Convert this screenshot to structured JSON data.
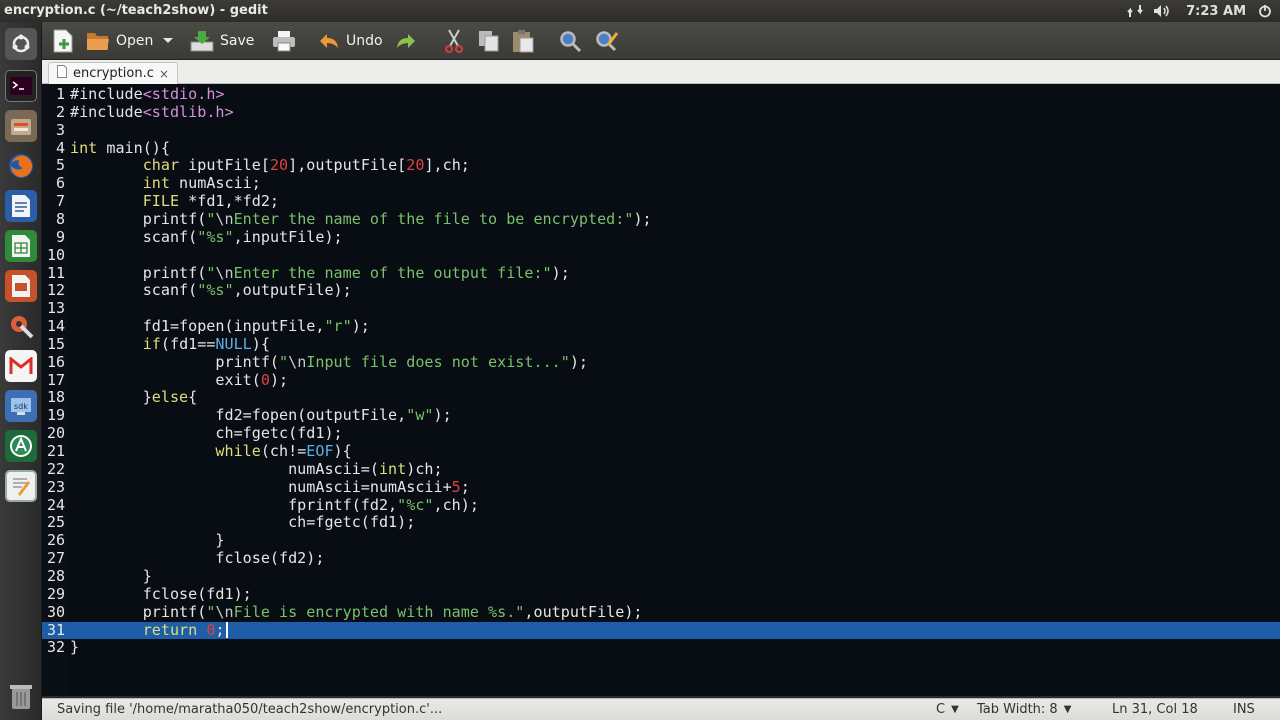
{
  "window": {
    "title": "encryption.c (~/teach2show) - gedit"
  },
  "panel": {
    "clock": "7:23 AM"
  },
  "toolbar": {
    "open_label": "Open",
    "save_label": "Save",
    "undo_label": "Undo"
  },
  "tab": {
    "label": "encryption.c",
    "close": "×"
  },
  "editor": {
    "current_line": 31,
    "lines": [
      {
        "n": "1",
        "text": "#include<stdio.h>"
      },
      {
        "n": "2",
        "text": "#include<stdlib.h>"
      },
      {
        "n": "3",
        "text": ""
      },
      {
        "n": "4",
        "text": "int main(){"
      },
      {
        "n": "5",
        "text": "        char iputFile[20],outputFile[20],ch;"
      },
      {
        "n": "6",
        "text": "        int numAscii;"
      },
      {
        "n": "7",
        "text": "        FILE *fd1,*fd2;"
      },
      {
        "n": "8",
        "text": "        printf(\"\\nEnter the name of the file to be encrypted:\");"
      },
      {
        "n": "9",
        "text": "        scanf(\"%s\",inputFile);"
      },
      {
        "n": "10",
        "text": ""
      },
      {
        "n": "11",
        "text": "        printf(\"\\nEnter the name of the output file:\");"
      },
      {
        "n": "12",
        "text": "        scanf(\"%s\",outputFile);"
      },
      {
        "n": "13",
        "text": ""
      },
      {
        "n": "14",
        "text": "        fd1=fopen(inputFile,\"r\");"
      },
      {
        "n": "15",
        "text": "        if(fd1==NULL){"
      },
      {
        "n": "16",
        "text": "                printf(\"\\nInput file does not exist...\");"
      },
      {
        "n": "17",
        "text": "                exit(0);"
      },
      {
        "n": "18",
        "text": "        }else{"
      },
      {
        "n": "19",
        "text": "                fd2=fopen(outputFile,\"w\");"
      },
      {
        "n": "20",
        "text": "                ch=fgetc(fd1);"
      },
      {
        "n": "21",
        "text": "                while(ch!=EOF){"
      },
      {
        "n": "22",
        "text": "                        numAscii=(int)ch;"
      },
      {
        "n": "23",
        "text": "                        numAscii=numAscii+5;"
      },
      {
        "n": "24",
        "text": "                        fprintf(fd2,\"%c\",ch);"
      },
      {
        "n": "25",
        "text": "                        ch=fgetc(fd1);"
      },
      {
        "n": "26",
        "text": "                }"
      },
      {
        "n": "27",
        "text": "                fclose(fd2);"
      },
      {
        "n": "28",
        "text": "        }"
      },
      {
        "n": "29",
        "text": "        fclose(fd1);"
      },
      {
        "n": "30",
        "text": "        printf(\"\\nFile is encrypted with name %s.\",outputFile);"
      },
      {
        "n": "31",
        "text": "        return 0;"
      },
      {
        "n": "32",
        "text": "}"
      }
    ]
  },
  "statusbar": {
    "message": "Saving file '/home/maratha050/teach2show/encryption.c'...",
    "language": "C",
    "tab_width": "Tab Width: 8",
    "position": "Ln 31, Col 18",
    "mode": "INS"
  },
  "colors": {
    "editor_bg": "#080c13",
    "current_line": "#1c5fa8",
    "keyword": "#dede7a",
    "string": "#7ac16b",
    "number": "#e0413f",
    "constant": "#5bb0e8"
  },
  "icons": {
    "launcher": [
      "dash-icon",
      "terminal-icon",
      "files-icon",
      "firefox-icon",
      "writer-icon",
      "calc-icon",
      "impress-icon",
      "settings-icon",
      "gmail-icon",
      "sdk-icon",
      "android-icon",
      "text-editor-icon",
      "trash-icon"
    ],
    "toolbar": [
      "new-document-icon",
      "open-icon",
      "save-icon",
      "print-icon",
      "undo-icon",
      "redo-icon",
      "cut-icon",
      "copy-icon",
      "paste-icon",
      "find-icon",
      "replace-icon"
    ]
  }
}
